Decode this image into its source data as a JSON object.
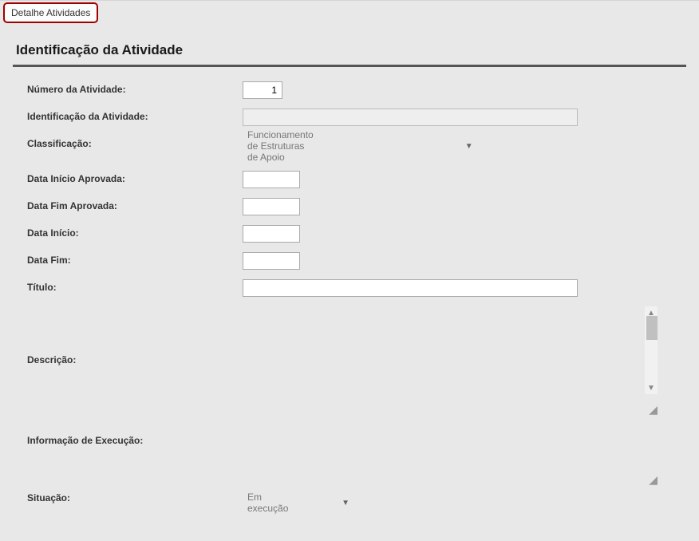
{
  "tab": {
    "label": "Detalhe Atividades"
  },
  "section": {
    "title": "Identificação da Atividade"
  },
  "fields": {
    "numero_atividade": {
      "label": "Número da Atividade:",
      "value": "1"
    },
    "identificacao": {
      "label": "Identificação da Atividade:",
      "value": ""
    },
    "classificacao": {
      "label": "Classificação:",
      "selected": "Funcionamento de Estruturas de Apoio"
    },
    "data_inicio_aprovada": {
      "label": "Data Início Aprovada:",
      "value": ""
    },
    "data_fim_aprovada": {
      "label": "Data Fim Aprovada:",
      "value": ""
    },
    "data_inicio": {
      "label": "Data Início:",
      "value": ""
    },
    "data_fim": {
      "label": "Data Fim:",
      "value": ""
    },
    "titulo": {
      "label": "Título:",
      "value": ""
    },
    "descricao": {
      "label": "Descrição:",
      "value": ""
    },
    "info_execucao": {
      "label": "Informação de Execução:",
      "value": ""
    },
    "situacao": {
      "label": "Situação:",
      "selected": "Em execução"
    }
  }
}
